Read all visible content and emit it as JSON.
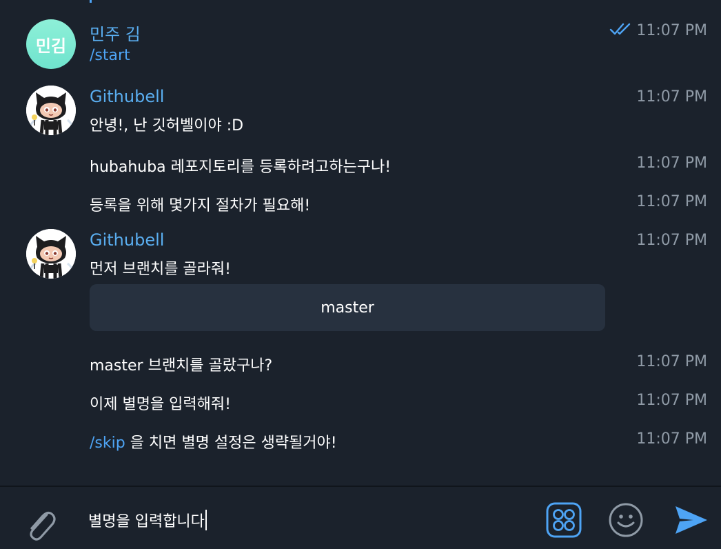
{
  "messages": {
    "m1": {
      "avatar_initials": "민김",
      "sender": "민주 김",
      "text": "/start",
      "time": "11:07 PM"
    },
    "m2": {
      "sender": "Githubell",
      "text": "안녕!, 난 깃허벨이야 :D",
      "time": "11:07 PM"
    },
    "m3": {
      "text": "hubahuba 레포지토리를 등록하려고하는구나!",
      "time": "11:07 PM"
    },
    "m4": {
      "text": "등록을 위해 몇가지 절차가 필요해!",
      "time": "11:07 PM"
    },
    "m5": {
      "sender": "Githubell",
      "text": "먼저 브랜치를 골라줘!",
      "time": "11:07 PM",
      "keyboard_button": "master"
    },
    "m6": {
      "text": "master 브랜치를 골랐구나?",
      "time": "11:07 PM"
    },
    "m7": {
      "text": "이제 별명을 입력해줘!",
      "time": "11:07 PM"
    },
    "m8": {
      "command": "/skip",
      "text": " 을 치면 별명 설정은 생략될거야!",
      "time": "11:07 PM"
    }
  },
  "composer": {
    "value": "별명을 입력합니다"
  },
  "icons": {
    "read": "double-check-icon",
    "attach": "paperclip-icon",
    "commands": "bot-commands-icon",
    "emoji": "smiley-icon",
    "send": "send-icon"
  },
  "colors": {
    "background": "#1b222c",
    "accent": "#4ea4f5",
    "sender": "#5aaef0",
    "time": "#8f9aa6",
    "button": "#27313f",
    "avatar": "#7ee8d2"
  }
}
